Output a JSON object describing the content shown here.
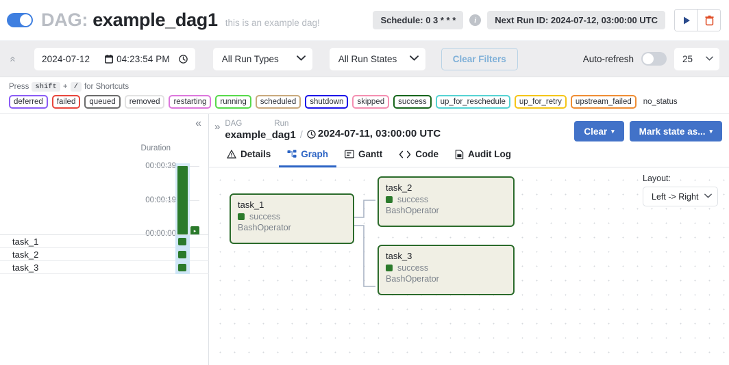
{
  "header": {
    "toggle_on": true,
    "dag_prefix": "DAG:",
    "dag_name": "example_dag1",
    "dag_description": "this is an example dag!",
    "schedule_pill": "Schedule: 0 3 * * *",
    "info_glyph": "i",
    "next_run_pill": "Next Run ID: 2024-07-12, 03:00:00 UTC",
    "trigger_icon": "play-icon",
    "delete_icon": "trash-icon"
  },
  "filters": {
    "collapse_glyph": "«",
    "date_value": "2024-07-12",
    "time_value": "04:23:54 PM",
    "run_types_value": "All Run Types",
    "run_states_value": "All Run States",
    "clear_filters_label": "Clear Filters",
    "auto_refresh_label": "Auto-refresh",
    "auto_refresh_on": false,
    "count_value": "25"
  },
  "shortcuts": {
    "press_label": "Press",
    "key_shift": "shift",
    "plus": "+",
    "key_slash": "/",
    "for_label": "for Shortcuts"
  },
  "legend": [
    {
      "label": "deferred",
      "color": "#8b5cf6"
    },
    {
      "label": "failed",
      "color": "#e8453c"
    },
    {
      "label": "queued",
      "color": "#6b6b6b"
    },
    {
      "label": "removed",
      "color": "#e2e2e2"
    },
    {
      "label": "restarting",
      "color": "#dd77dd"
    },
    {
      "label": "running",
      "color": "#56d94a"
    },
    {
      "label": "scheduled",
      "color": "#c9a97c"
    },
    {
      "label": "shutdown",
      "color": "#1b12e8"
    },
    {
      "label": "skipped",
      "color": "#f48fb1"
    },
    {
      "label": "success",
      "color": "#16651b"
    },
    {
      "label": "up_for_reschedule",
      "color": "#55d3d3"
    },
    {
      "label": "up_for_retry",
      "color": "#f5c518"
    },
    {
      "label": "upstream_failed",
      "color": "#ef8d33"
    }
  ],
  "legend_no_status": "no_status",
  "grid": {
    "collapse_glyph": "«",
    "duration_title": "Duration",
    "y_ticks": [
      "00:00:39",
      "00:00:19",
      "00:00:00"
    ],
    "bars": [
      {
        "height_pct": 100,
        "selected": true,
        "label": ""
      },
      {
        "height_pct": 4,
        "selected": false,
        "label": "▸"
      }
    ],
    "tasks": [
      {
        "name": "task_1",
        "state": "success"
      },
      {
        "name": "task_2",
        "state": "success"
      },
      {
        "name": "task_3",
        "state": "success"
      }
    ]
  },
  "detail": {
    "expand_glyph": "»",
    "crumb_dag_label": "DAG",
    "crumb_run_label": "Run",
    "dag_value": "example_dag1",
    "separator": "/",
    "run_clock_icon": "clock-icon",
    "run_value": "2024-07-11, 03:00:00 UTC",
    "clear_button": "Clear",
    "mark_state_button": "Mark state as...",
    "caret": "▾",
    "tabs": [
      {
        "label": "Details",
        "icon": "warning-triangle-icon",
        "active": false
      },
      {
        "label": "Graph",
        "icon": "graph-icon",
        "active": true
      },
      {
        "label": "Gantt",
        "icon": "gantt-icon",
        "active": false
      },
      {
        "label": "Code",
        "icon": "code-brackets-icon",
        "active": false
      },
      {
        "label": "Audit Log",
        "icon": "document-icon",
        "active": false
      }
    ]
  },
  "graph": {
    "layout_label": "Layout:",
    "layout_value": "Left -> Right",
    "nodes": [
      {
        "id": "task_1",
        "title": "task_1",
        "state": "success",
        "operator": "BashOperator"
      },
      {
        "id": "task_2",
        "title": "task_2",
        "state": "success",
        "operator": "BashOperator"
      },
      {
        "id": "task_3",
        "title": "task_3",
        "state": "success",
        "operator": "BashOperator"
      }
    ],
    "edges": [
      {
        "from": "task_1",
        "to": "task_2"
      },
      {
        "from": "task_1",
        "to": "task_3"
      }
    ]
  },
  "colors": {
    "success_green": "#2b7a2b",
    "node_bg": "#f0efe4",
    "node_border": "#2b6b2b",
    "primary_blue": "#4272c8",
    "selected_col": "#cfe6f7"
  }
}
